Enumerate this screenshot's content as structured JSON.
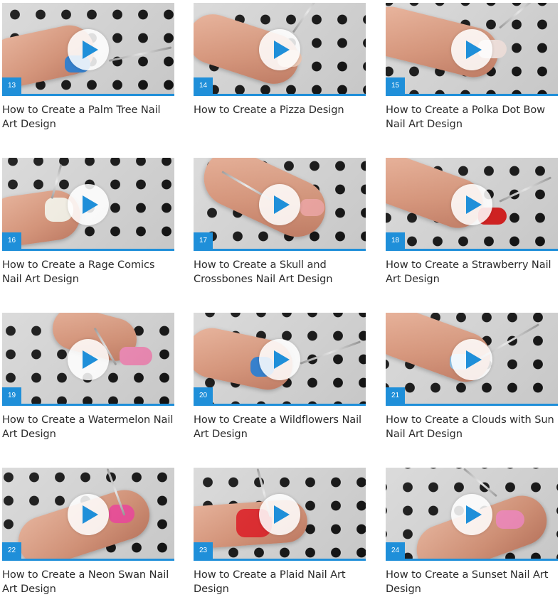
{
  "videos": [
    {
      "number": "13",
      "title": "How to Create a Palm Tree Nail Art Design",
      "nail_color": "#2f7fd1"
    },
    {
      "number": "14",
      "title": "How to Create a Pizza Design",
      "nail_color": "#f4cdb8"
    },
    {
      "number": "15",
      "title": "How to Create a Polka Dot Bow Nail Art Design",
      "nail_color": "#f6e6e1"
    },
    {
      "number": "16",
      "title": "How to Create a Rage Comics Nail Art Design",
      "nail_color": "#f7f3e8"
    },
    {
      "number": "17",
      "title": "How to Create a Skull and Crossbones Nail Art Design",
      "nail_color": "#f3a8a4"
    },
    {
      "number": "18",
      "title": "How to Create a Strawberry Nail Art Design",
      "nail_color": "#d81d1d"
    },
    {
      "number": "19",
      "title": "How to Create a Watermelon Nail Art Design",
      "nail_color": "#f28bb7"
    },
    {
      "number": "20",
      "title": "How to Create a Wildflowers Nail Art Design",
      "nail_color": "#2f7fd1"
    },
    {
      "number": "21",
      "title": "How to Create a Clouds with Sun Nail Art Design",
      "nail_color": "#8ec8f0"
    },
    {
      "number": "22",
      "title": "How to Create a Neon Swan Nail Art Design",
      "nail_color": "#f04f9a"
    },
    {
      "number": "23",
      "title": "How to Create a Plaid Nail Art Design",
      "nail_color": "#e0262a"
    },
    {
      "number": "24",
      "title": "How to Create a Sunset Nail Art Design",
      "nail_color": "#f48cbb"
    }
  ],
  "play_icon": "play-icon",
  "accent_color": "#1f8fd9"
}
